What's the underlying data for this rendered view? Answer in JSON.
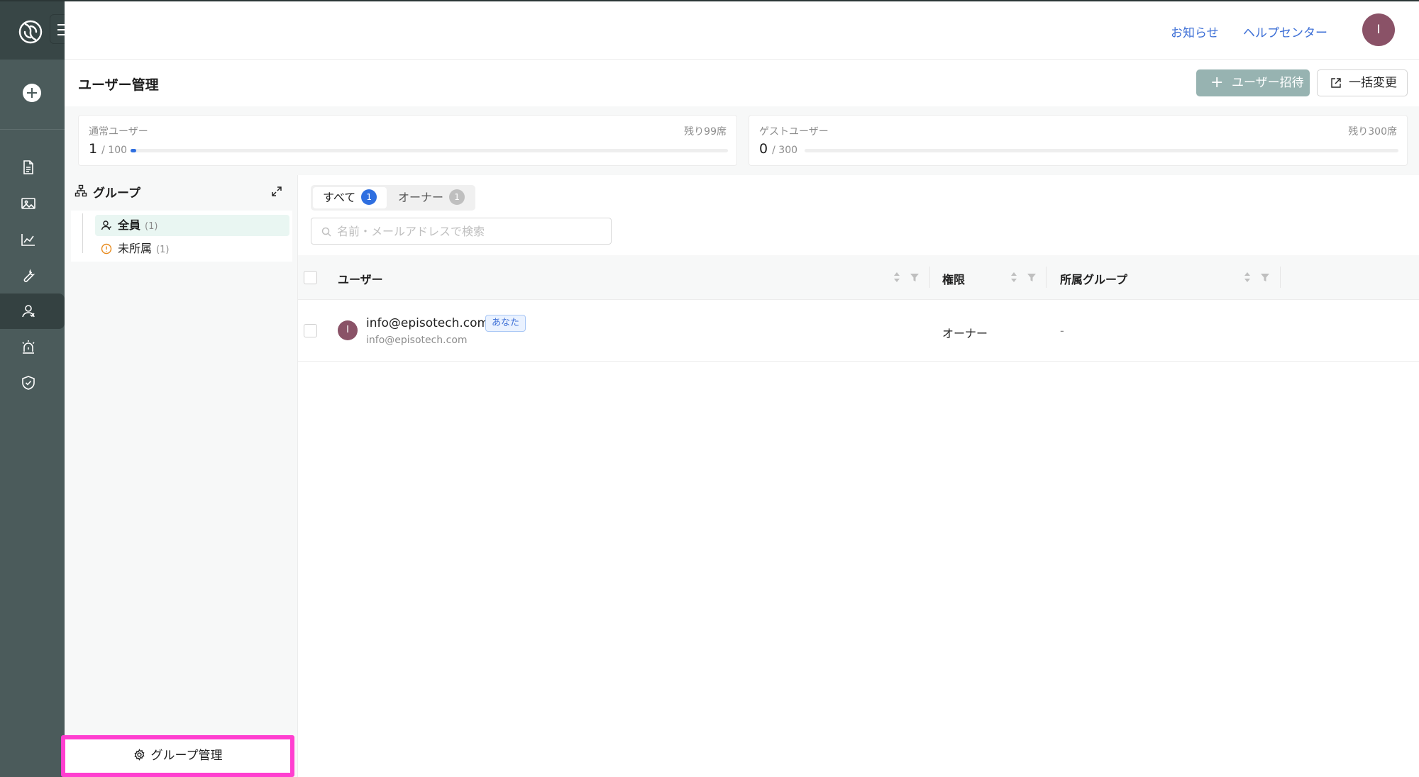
{
  "header": {
    "notifications_label": "お知らせ",
    "help_center_label": "ヘルプセンター",
    "avatar_initial": "I"
  },
  "page": {
    "title": "ユーザー管理",
    "invite_button": "ユーザー招待",
    "bulk_change_button": "一括変更"
  },
  "quota": {
    "regular": {
      "label": "通常ユーザー",
      "used": "1",
      "total": "/ 100",
      "remaining": "残り99席",
      "fill_percent": 1
    },
    "guest": {
      "label": "ゲストユーザー",
      "used": "0",
      "total": "/ 300",
      "remaining": "残り300席",
      "fill_percent": 0
    }
  },
  "groups": {
    "title": "グループ",
    "items": [
      {
        "label": "全員",
        "count": "(1)"
      },
      {
        "label": "未所属",
        "count": "(1)"
      }
    ],
    "manage_button": "グループ管理"
  },
  "tabs": [
    {
      "label": "すべて",
      "count": "1"
    },
    {
      "label": "オーナー",
      "count": "1"
    }
  ],
  "search": {
    "placeholder": "名前・メールアドレスで検索"
  },
  "table": {
    "columns": [
      "ユーザー",
      "権限",
      "所属グループ"
    ],
    "rows": [
      {
        "avatar": "I",
        "name": "info@episotech.com",
        "tag": "あなた",
        "email": "info@episotech.com",
        "role": "オーナー",
        "group": "-"
      }
    ]
  },
  "colors": {
    "sidebar": "#4b5b5b",
    "accent_blue": "#2f6fe0",
    "invite_button": "#97b3b1",
    "avatar": "#8a5267",
    "highlight": "#ff3fd0"
  }
}
